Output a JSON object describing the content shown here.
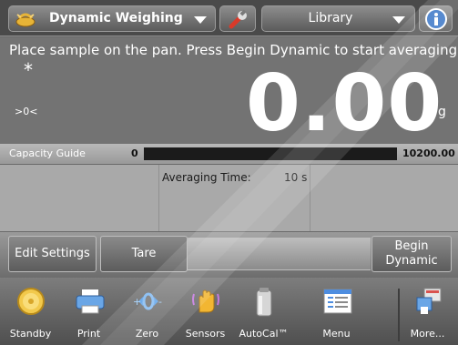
{
  "topbar": {
    "mode_label": "Dynamic Weighing",
    "mode_icon": "dynamic-weighing-icon",
    "settings_icon": "wrench-icon",
    "library_label": "Library",
    "info_icon": "info-icon"
  },
  "display": {
    "instruction": "Place sample on the pan.  Press Begin Dynamic to start averaging.",
    "stability_indicator": "*",
    "zero_indicator": ">0<",
    "weight": "0.00",
    "unit": "g"
  },
  "capacity_guide": {
    "label": "Capacity Guide",
    "min": "0",
    "max": "10200.00",
    "fill_fraction": 0
  },
  "info": {
    "averaging_label": "Averaging Time:",
    "averaging_value": "10 s"
  },
  "actions": {
    "edit_settings": "Edit Settings",
    "tare": "Tare",
    "begin_line1": "Begin",
    "begin_line2": "Dynamic"
  },
  "nav": {
    "items": [
      {
        "label": "Standby",
        "icon": "standby-icon"
      },
      {
        "label": "Print",
        "icon": "print-icon"
      },
      {
        "label": "Zero",
        "icon": "zero-icon"
      },
      {
        "label": "Sensors",
        "icon": "sensors-icon"
      },
      {
        "label": "AutoCal™",
        "icon": "autocal-icon"
      },
      {
        "label": "Menu",
        "icon": "menu-icon"
      },
      {
        "label": "More...",
        "icon": "more-icon"
      }
    ]
  },
  "colors": {
    "background": "#6a6a6a",
    "display_bg": "#737373",
    "capacity_bar": "#1b1b1b",
    "text": "#ffffff"
  }
}
